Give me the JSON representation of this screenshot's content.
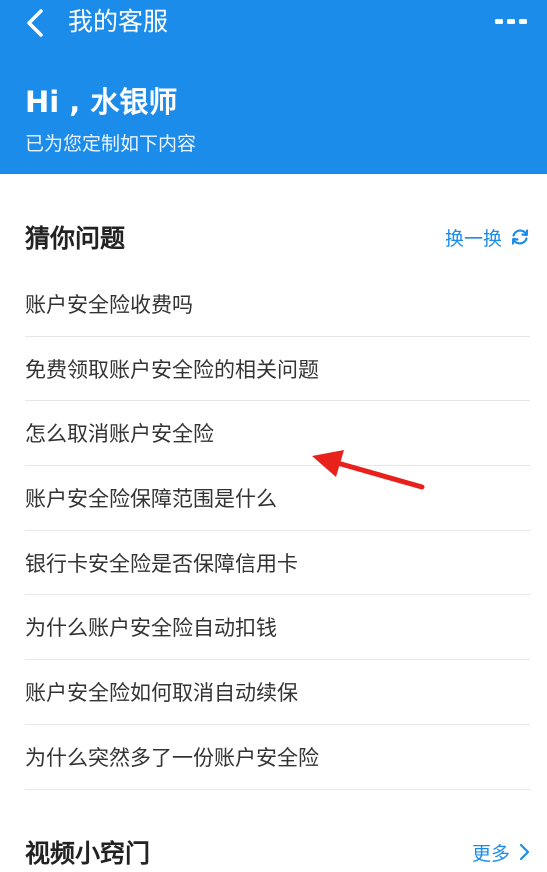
{
  "header": {
    "nav_title": "我的客服",
    "greeting": "Hi , 水银师",
    "subtitle": "已为您定制如下内容",
    "back_icon": "chevron-left-icon",
    "more_icon": "more-dots-icon",
    "bg_color": "#1c8ceb"
  },
  "guess": {
    "title": "猜你问题",
    "refresh_label": "换一换",
    "refresh_icon": "refresh-icon",
    "questions": [
      "账户安全险收费吗",
      "免费领取账户安全险的相关问题",
      "怎么取消账户安全险",
      "账户安全险保障范围是什么",
      "银行卡安全险是否保障信用卡",
      "为什么账户安全险自动扣钱",
      "账户安全险如何取消自动续保",
      "为什么突然多了一份账户安全险"
    ]
  },
  "videos": {
    "title": "视频小窍门",
    "more_label": "更多",
    "more_icon": "chevron-right-icon"
  },
  "annotation": {
    "arrow_icon": "red-arrow-icon",
    "color": "#e8211d"
  }
}
